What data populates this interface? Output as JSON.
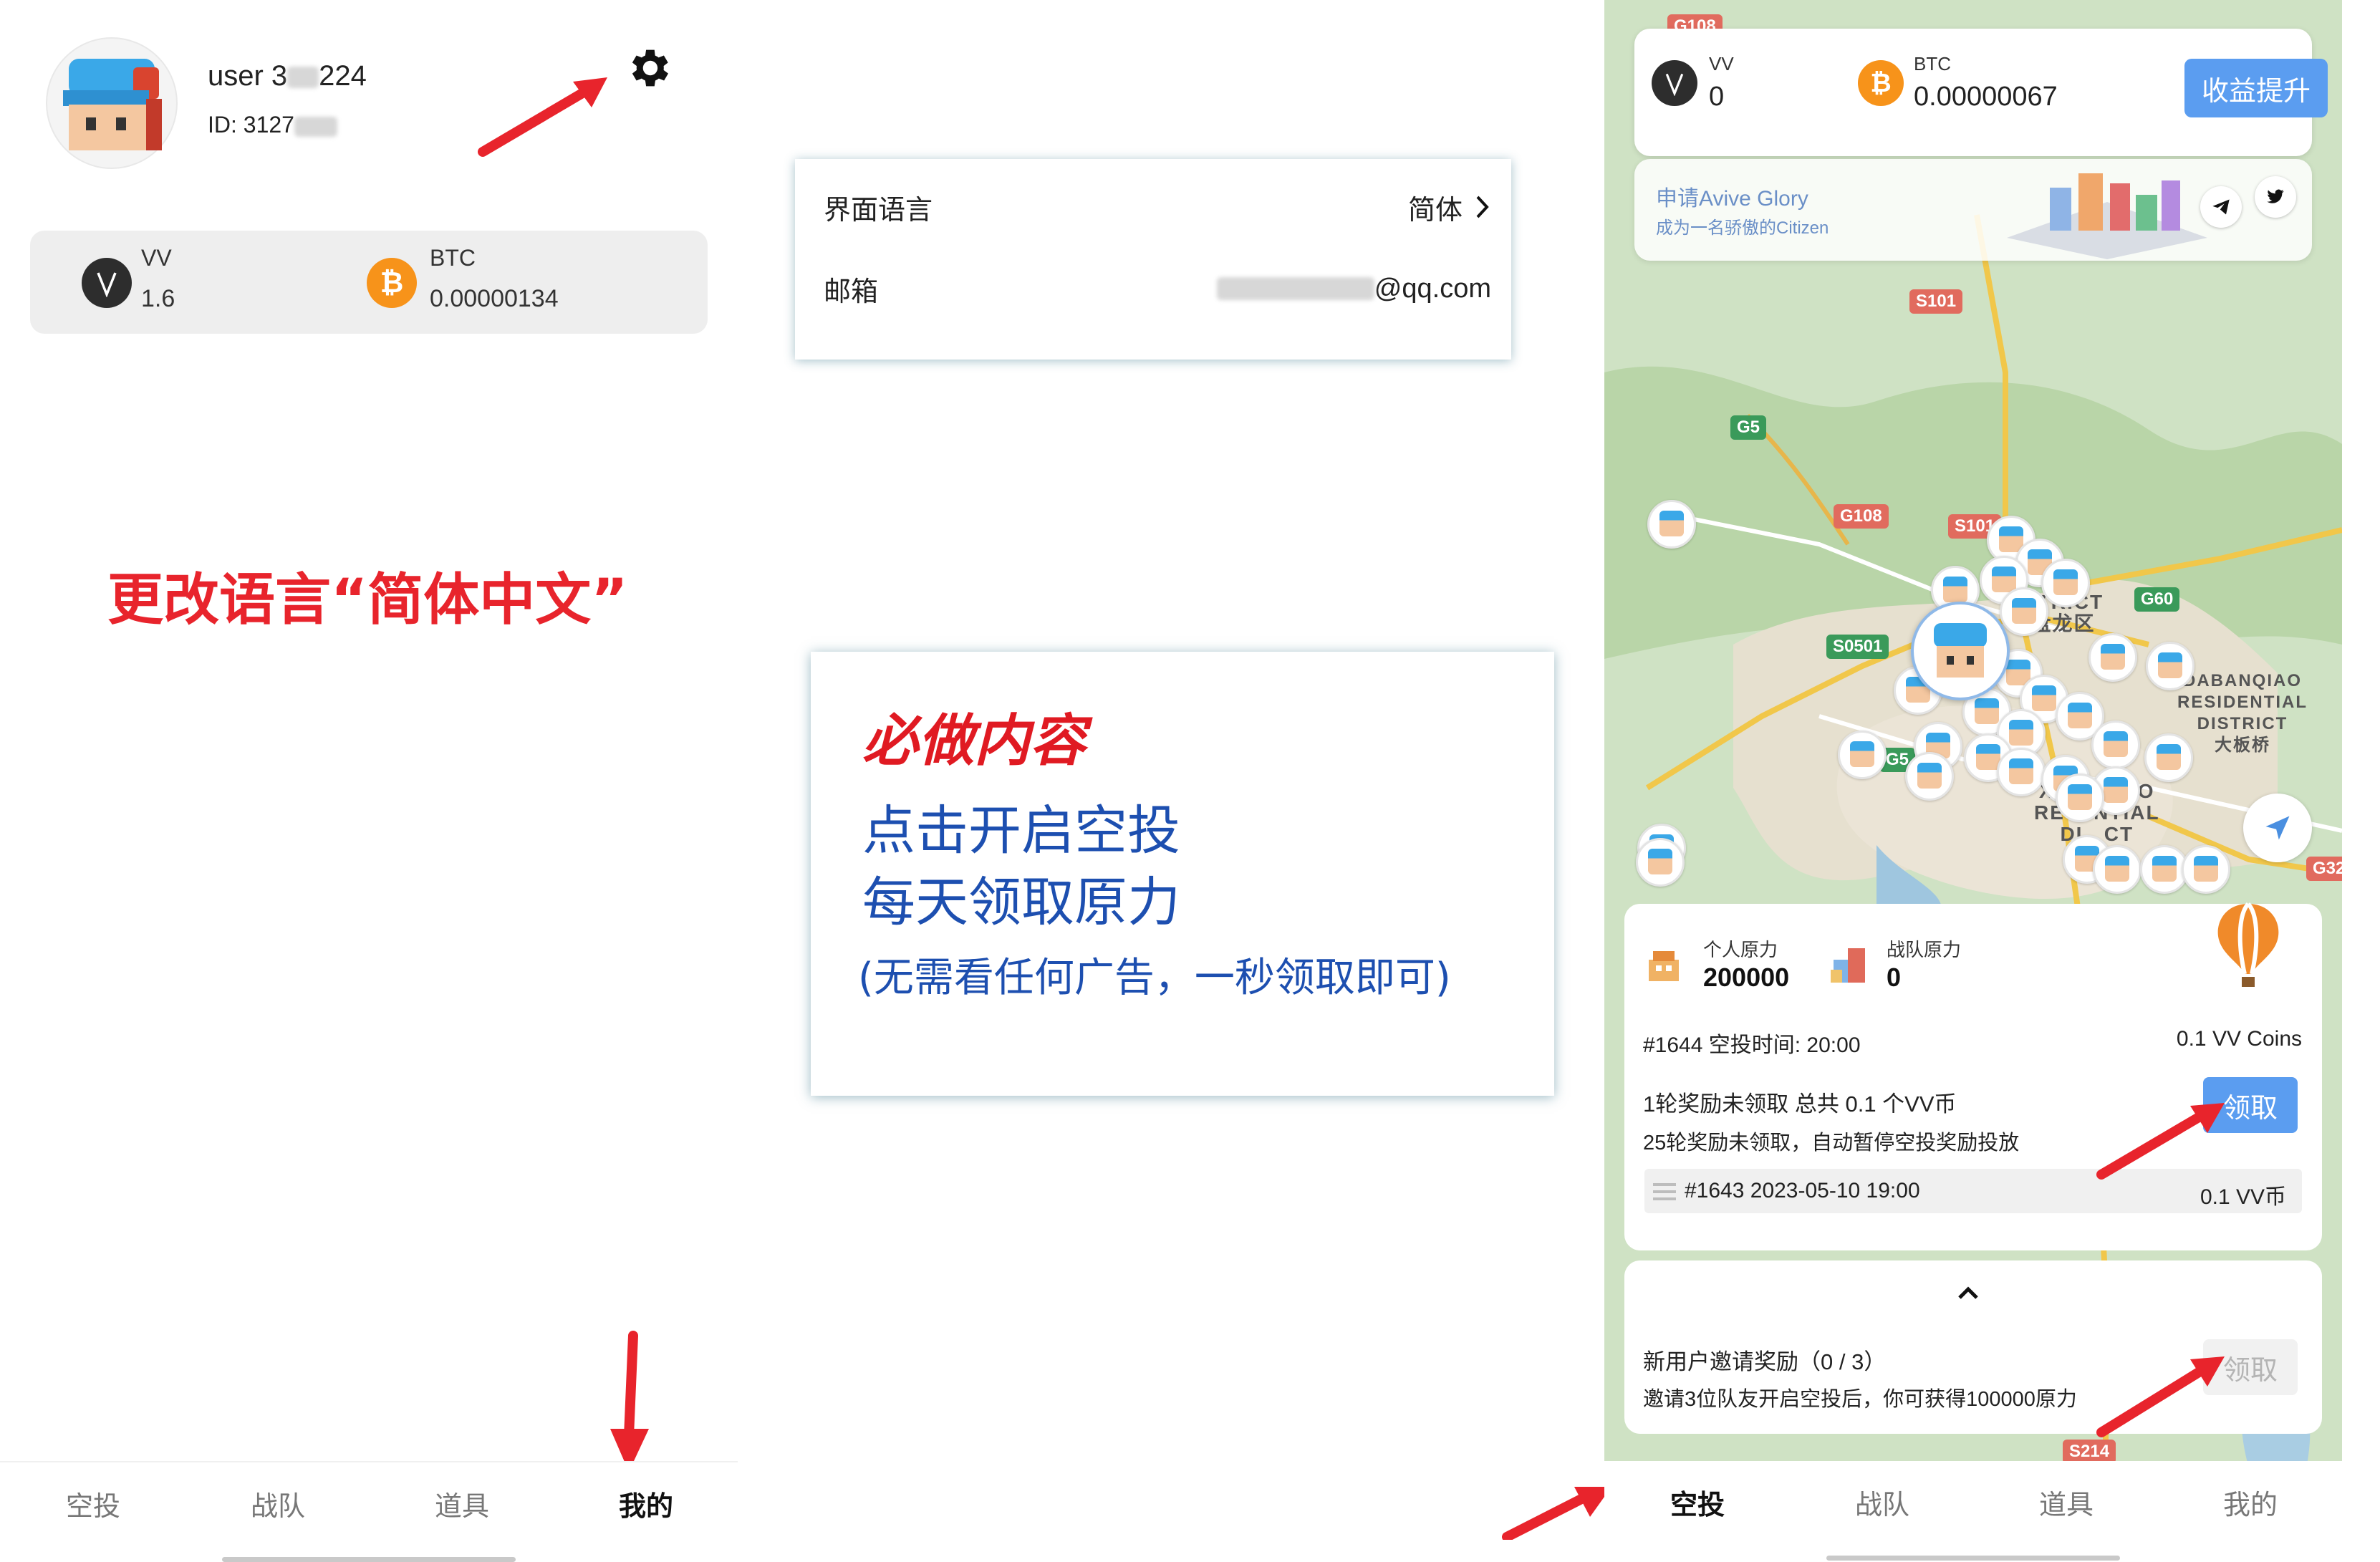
{
  "left": {
    "username": "user 3",
    "username_tail": "224",
    "user_id": "ID: 3127",
    "balances": [
      {
        "coin": "VV",
        "value": "1.6"
      },
      {
        "coin": "BTC",
        "value": "0.00000134"
      }
    ],
    "caption": "更改语言“简体中文”",
    "nav": [
      "空投",
      "战队",
      "道具",
      "我的"
    ],
    "nav_active": "我的"
  },
  "settings": {
    "language_label": "界面语言",
    "language_value": "简体",
    "email_label": "邮箱",
    "email_value": "@qq.com"
  },
  "info": {
    "title": "必做内容",
    "line1": "点击开启空投",
    "line2": "每天领取原力",
    "note": "(无需看任何广告，一秒领取即可)"
  },
  "right": {
    "balances": [
      {
        "coin": "VV",
        "value": "0"
      },
      {
        "coin": "BTC",
        "value": "0.00000067"
      }
    ],
    "promo_button": "收益提升",
    "glory_title": "申请Avive Glory",
    "glory_sub": "成为一名骄傲的Citizen",
    "map_roads": [
      "G108",
      "S101",
      "G5",
      "G108",
      "S101",
      "S0501",
      "G60",
      "G5",
      "G32",
      "S214"
    ],
    "map_districts": [
      "ONG\nSTRICT\n盘龙区",
      "DABANQIAO\nRESIDENTIAL\nDISTRICT\n大板桥",
      "XI   NQIAO\nRES  NTIAL\nDI   CT"
    ],
    "personal_force_label": "个人原力",
    "personal_force_value": "200000",
    "team_force_label": "战队原力",
    "team_force_value": "0",
    "airdrop_round": "#1644 空投时间: 20:00",
    "airdrop_amount": "0.1 VV Coins",
    "unclaimed_line": "1轮奖励未领取 总共 0.1 个VV币",
    "pause_note": "25轮奖励未领取，自动暂停空投奖励投放",
    "claim_label": "领取",
    "history_round": "#1643 2023-05-10 19:00",
    "history_amount": "0.1 VV币",
    "invite_title": "新用户邀请奖励（0 / 3）",
    "invite_desc": "邀请3位队友开启空投后，你可获得100000原力",
    "invite_claim_label": "领取",
    "nav": [
      "空投",
      "战队",
      "道具",
      "我的"
    ],
    "nav_active": "空投"
  },
  "colors": {
    "accent_blue": "#5b9df0",
    "annotation_red": "#e8242c",
    "info_blue": "#1d4fb0",
    "btc_orange": "#f7931a"
  }
}
